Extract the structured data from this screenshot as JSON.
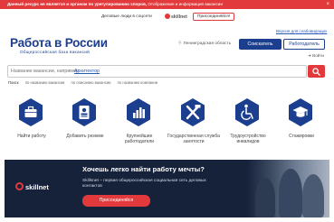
{
  "alert": {
    "text_bold": "Данный ресурс не является и органом по урегулированию споров,",
    "text": "Отображение и информация вакансии",
    "close_symbol": "×"
  },
  "skillnet_strip": {
    "text": "Деловые люди в соцсети",
    "logo": "skillnet",
    "join_label": "Присоединяйся!"
  },
  "header": {
    "employer_version_link": "Версия для слабовидящих",
    "logo_title": "Работа в России",
    "logo_subtitle": "Общероссийская база вакансий",
    "region": "Ленинградская область",
    "seeker_button": "Соискатель",
    "employer_button": "Работодатель",
    "login": "Войти"
  },
  "search": {
    "placeholder": "Название вакансии, например:",
    "hint": "Архитектор"
  },
  "filters": {
    "items": [
      "Поиск",
      "по названию вакансии",
      "по описанию вакансии",
      "по названию компании"
    ]
  },
  "categories": [
    {
      "label": "Найти работу",
      "icon": "briefcase-icon"
    },
    {
      "label": "Добавить резюме",
      "icon": "resume-badge-icon"
    },
    {
      "label": "Крупнейшие работодатели",
      "icon": "bar-chart-icon"
    },
    {
      "label": "Государственная служба занятости",
      "icon": "tools-icon"
    },
    {
      "label": "Трудоустройство инвалидов",
      "icon": "wheelchair-icon"
    },
    {
      "label": "Стажировки",
      "icon": "graduation-cap-icon"
    }
  ],
  "banner": {
    "logo": "skillnet",
    "title": "Хочешь легко найти работу мечты?",
    "text": "Skillsnet – первая общероссийская социальная сеть деловых контактов",
    "button": "Присоединяйся"
  },
  "colors": {
    "brand_blue": "#1b3e8f",
    "accent_red": "#e23a3c",
    "banner_dark": "#16213a"
  }
}
